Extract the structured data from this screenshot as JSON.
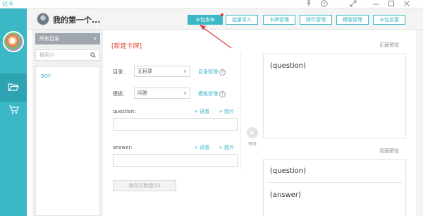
{
  "app": {
    "name": "记卡",
    "window_controls": [
      "pin-icon",
      "help-icon",
      "expand-icon",
      "minimize-icon",
      "maximize-icon",
      "close-icon"
    ]
  },
  "header": {
    "deck_title": "我的第一个...",
    "buttons": [
      {
        "label": "卡包发布",
        "primary": true
      },
      {
        "label": "批量导入",
        "primary": false
      },
      {
        "label": "卡牌管理",
        "primary": false
      },
      {
        "label": "附件管理",
        "primary": false
      },
      {
        "label": "模版管理",
        "primary": false
      },
      {
        "label": "卡包设置",
        "primary": false
      }
    ]
  },
  "sidebar": {
    "directory_select": "所有目录",
    "search_placeholder": "搜索(/)",
    "items": [
      {
        "label": "BOY"
      }
    ]
  },
  "form": {
    "heading": "[新建卡牌]",
    "directory": {
      "label": "目录：",
      "value": "无目录",
      "link": "目录管理"
    },
    "template": {
      "label": "模板：",
      "value": "问答",
      "link": "模板管理"
    },
    "question": {
      "label": "question:",
      "add_voice": "+ 语音",
      "add_image": "+ 图片"
    },
    "answer": {
      "label": "answer:",
      "add_voice": "+ 语音",
      "add_image": "+ 图片"
    },
    "save_button": "保存并新建(S)"
  },
  "preview": {
    "toggle_label": "预览",
    "front_label": "正面预览",
    "front_text": "(question)",
    "back_label": "背面预览",
    "back_question": "(question)",
    "back_answer": "(answer)"
  },
  "colors": {
    "accent": "#3bb7c5",
    "heading_red": "#e24b3b",
    "annotation_red": "#e03a3a"
  }
}
